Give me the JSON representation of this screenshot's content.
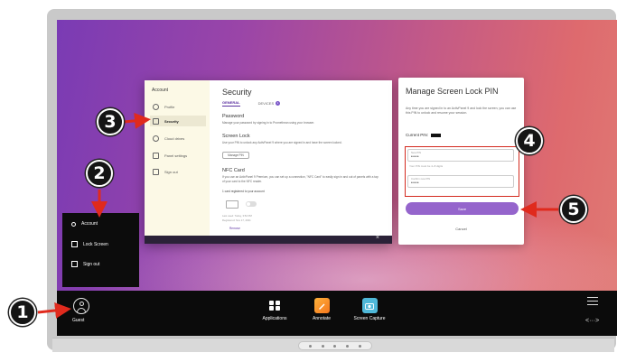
{
  "security_window": {
    "sidebar_title": "Account",
    "sidebar_items": [
      {
        "label": "Profile",
        "icon": "person-icon"
      },
      {
        "label": "Security",
        "icon": "lock-icon"
      },
      {
        "label": "Cloud drives",
        "icon": "cloud-icon"
      },
      {
        "label": "Panel settings",
        "icon": "panel-icon"
      },
      {
        "label": "Sign out",
        "icon": "signout-icon"
      }
    ],
    "active_item": "Security",
    "title": "Security",
    "tabs": {
      "general": "GENERAL",
      "devices": "DEVICES",
      "devices_badge": "1"
    },
    "password_heading": "Password",
    "password_text": "Manage your password by signing in to Promethean using your browser.",
    "screen_lock_heading": "Screen Lock",
    "screen_lock_text": "Use your PIN to unlock any ActivPanel 9 where you are signed in and have the screen locked.",
    "manage_pin_label": "Manage PIN",
    "nfc_heading": "NFC Card",
    "nfc_text": "If you use an ActivPanel 9 Premium, you can set up a connection, \"NFC Card\" to easily sign in and out of panels with a tap of your card to the NFC reader.",
    "nfc_registered": "1 card registered to your account",
    "nfc_last_used": "Last used: Today, 3:52 PM",
    "nfc_registered_on": "Registered: Nov 17, 2021",
    "nfc_remove": "Remove",
    "close_glyph": "×"
  },
  "pin_panel": {
    "title": "Manage Screen Lock PIN",
    "description": "Any time you are signed in to an ActivPanel 9 and lock the screen, you can use this PIN to unlock and resume your session.",
    "current_pin_label": "Current PIN:",
    "new_pin_label": "New PIN",
    "new_pin_value": "••••",
    "hint": "Your PIN must be 4–8 digits",
    "confirm_label": "Confirm new PIN",
    "confirm_value": "••••",
    "save_label": "Save",
    "cancel_label": "Cancel"
  },
  "account_popup": {
    "items": [
      {
        "label": "Account",
        "icon": "person-icon"
      },
      {
        "label": "Lock Screen",
        "icon": "lock-icon"
      },
      {
        "label": "Sign out",
        "icon": "signout-icon"
      }
    ]
  },
  "taskbar": {
    "guest_label": "Guest",
    "apps": [
      {
        "label": "Applications",
        "icon": "grid-icon"
      },
      {
        "label": "Annotate",
        "icon": "annotate-icon"
      },
      {
        "label": "Screen Capture",
        "icon": "camera-icon"
      }
    ],
    "expand_glyph": "<···>"
  },
  "callouts": [
    "1",
    "2",
    "3",
    "4",
    "5"
  ],
  "colors": {
    "accent": "#9565cc",
    "callout_fill": "#151515",
    "highlight": "#d42a1f"
  }
}
